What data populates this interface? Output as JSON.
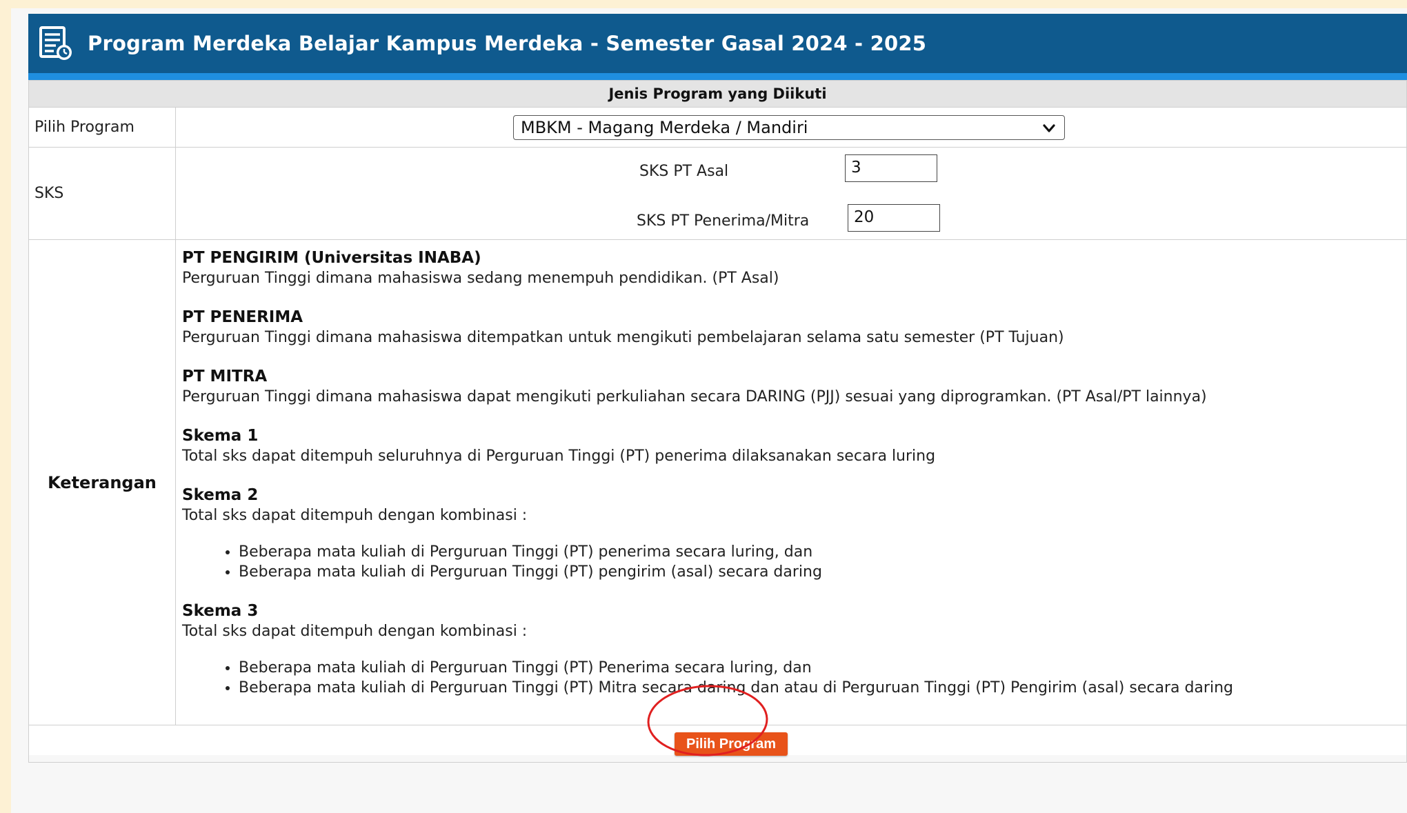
{
  "header": {
    "title": "Program Merdeka Belajar Kampus Merdeka - Semester Gasal 2024 - 2025",
    "icon": "document-clock-icon"
  },
  "table": {
    "section_header": "Jenis Program yang Diikuti",
    "program_label": "Pilih Program",
    "program_selected": "MBKM - Magang Merdeka / Mandiri",
    "sks_label": "SKS",
    "sks_pt_asal_label": "SKS PT Asal",
    "sks_pt_asal_value": "3",
    "sks_penerima_label": "SKS PT Penerima/Mitra",
    "sks_penerima_value": "20",
    "keterangan_label": "Keterangan"
  },
  "keterangan": {
    "pengirim_title": "PT PENGIRIM (Universitas INABA)",
    "pengirim_desc": "Perguruan Tinggi dimana mahasiswa sedang menempuh pendidikan. (PT Asal)",
    "penerima_title": "PT PENERIMA",
    "penerima_desc": "Perguruan Tinggi dimana mahasiswa ditempatkan untuk mengikuti pembelajaran selama satu semester (PT Tujuan)",
    "mitra_title": "PT MITRA",
    "mitra_desc": "Perguruan Tinggi dimana mahasiswa dapat mengikuti perkuliahan secara DARING (PJJ) sesuai yang diprogramkan. (PT Asal/PT lainnya)",
    "skema1_title": "Skema 1",
    "skema1_desc": "Total sks dapat ditempuh seluruhnya di Perguruan Tinggi (PT) penerima dilaksanakan secara luring",
    "skema2_title": "Skema 2",
    "skema2_desc": "Total sks dapat ditempuh dengan kombinasi :",
    "skema2_items": [
      "Beberapa mata kuliah di Perguruan Tinggi (PT) penerima secara luring, dan",
      "Beberapa mata kuliah di Perguruan Tinggi (PT) pengirim (asal) secara daring"
    ],
    "skema3_title": "Skema 3",
    "skema3_desc": "Total sks dapat ditempuh dengan kombinasi :",
    "skema3_items": [
      "Beberapa mata kuliah di Perguruan Tinggi (PT) Penerima secara luring, dan",
      "Beberapa mata kuliah di Perguruan Tinggi (PT) Mitra secara daring dan atau di Perguruan Tinggi (PT) Pengirim (asal) secara daring"
    ]
  },
  "action": {
    "pilih_program_label": "Pilih Program"
  },
  "colors": {
    "title_bar": "#0f5a8e",
    "title_bar_accent": "#1f8fe0",
    "button": "#e8531a",
    "highlight_ring": "#e02020",
    "background": "#fdf1d4"
  }
}
